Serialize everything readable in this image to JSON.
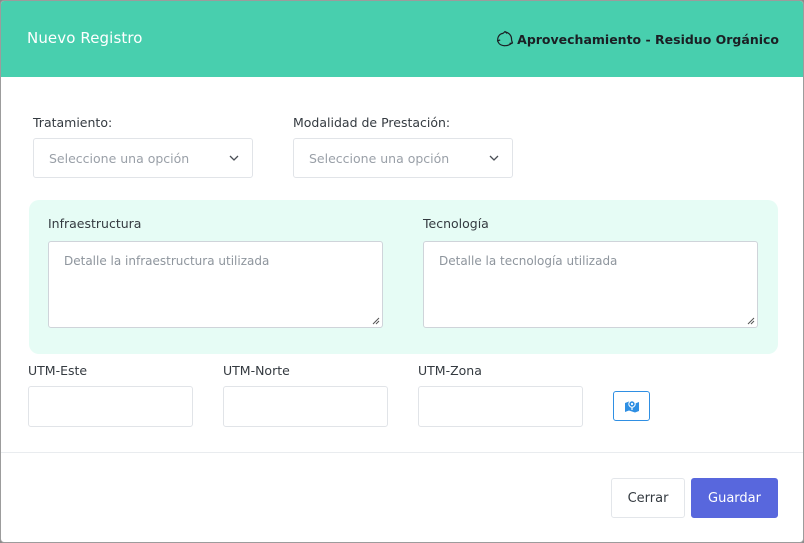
{
  "header": {
    "title": "Nuevo Registro",
    "context_label": "Aprovechamiento - Residuo Orgánico",
    "context_icon": "recycle-icon",
    "background_color": "#48cfae"
  },
  "form": {
    "tratamiento": {
      "label": "Tratamiento:",
      "selected": "Seleccione una opción"
    },
    "modalidad": {
      "label": "Modalidad de Prestación:",
      "selected": "Seleccione una opción"
    },
    "infraestructura": {
      "label": "Infraestructura",
      "placeholder": "Detalle la infraestructura utilizada",
      "value": ""
    },
    "tecnologia": {
      "label": "Tecnología",
      "placeholder": "Detalle la tecnología utilizada",
      "value": ""
    },
    "utm_este": {
      "label": "UTM-Este",
      "value": ""
    },
    "utm_norte": {
      "label": "UTM-Norte",
      "value": ""
    },
    "utm_zona": {
      "label": "UTM-Zona",
      "value": ""
    },
    "map_button_icon": "map-marker-icon"
  },
  "footer": {
    "close_label": "Cerrar",
    "save_label": "Guardar",
    "save_color": "#5867dd"
  }
}
